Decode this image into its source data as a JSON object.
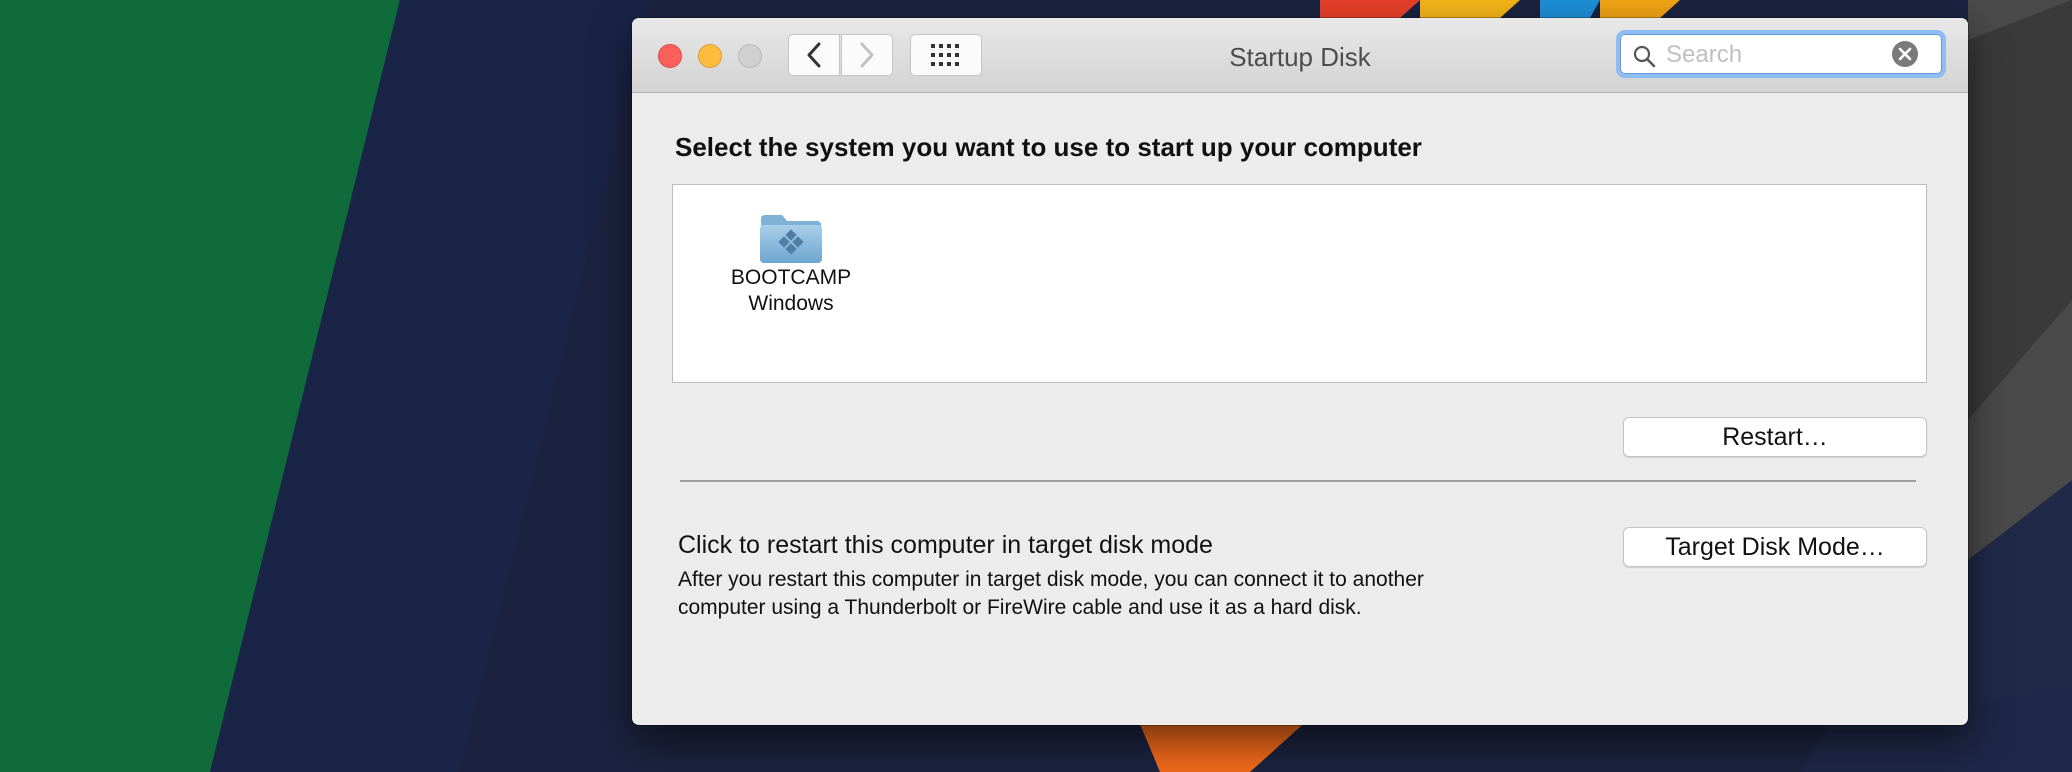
{
  "window": {
    "title": "Startup Disk"
  },
  "toolbar": {
    "back_icon": "chevron-left-icon",
    "forward_icon": "chevron-right-icon",
    "show_all_icon": "grid-icon"
  },
  "search": {
    "placeholder": "Search",
    "value": ""
  },
  "main": {
    "heading": "Select the system you want to use to start up your computer",
    "disks": [
      {
        "icon": "bootcamp-folder-icon",
        "name": "BOOTCAMP",
        "system": "Windows"
      }
    ],
    "restart_label": "Restart…",
    "target_disk": {
      "title": "Click to restart this computer in target disk mode",
      "description": "After you restart this computer in target disk mode, you can connect it to another computer using a Thunderbolt or FireWire cable and use it as a hard disk.",
      "button_label": "Target Disk Mode…"
    }
  },
  "colors": {
    "close": "#fc605c",
    "minimize": "#fdbc40",
    "zoom_disabled": "#d0d0d0",
    "search_focus": "#8fbcf2"
  }
}
